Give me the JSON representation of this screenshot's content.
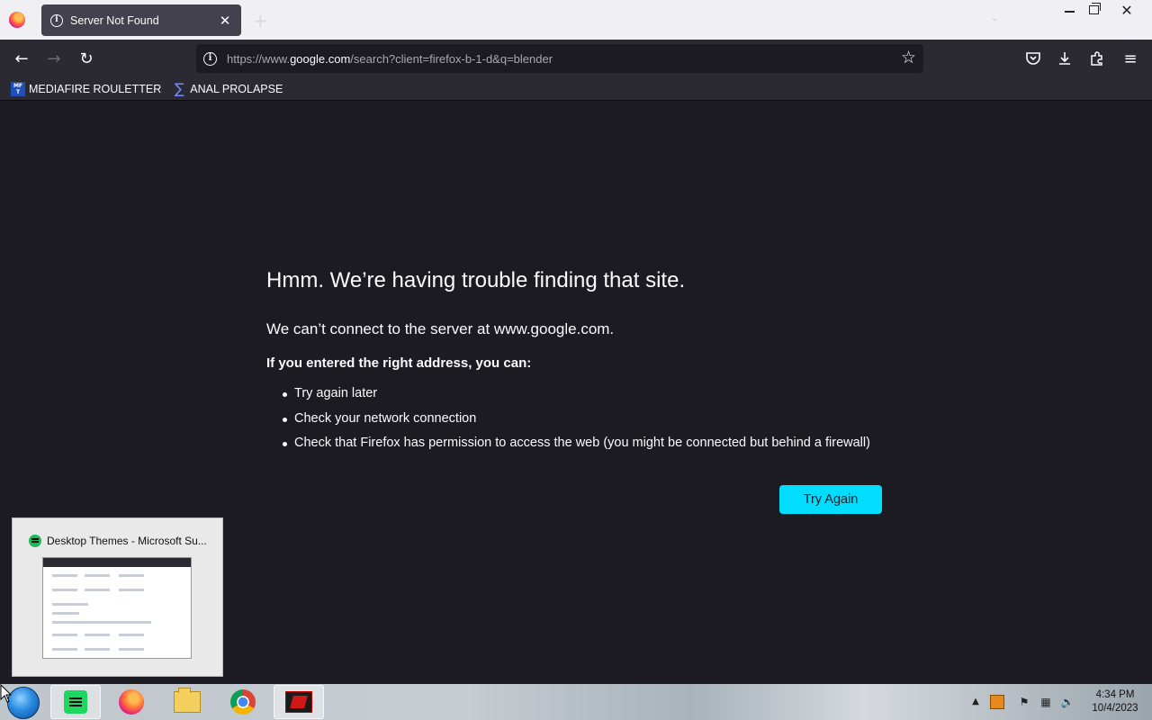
{
  "tab": {
    "title": "Server Not Found"
  },
  "urlbar": {
    "prefix": "https://www.",
    "host": "google.com",
    "path": "/search?client=firefox-b-1-d&q=blender"
  },
  "bookmarks": [
    {
      "label": "MEDIAFIRE ROULETTER",
      "icon_text": "MF T"
    },
    {
      "label": "ANAL PROLAPSE"
    }
  ],
  "error": {
    "title": "Hmm. We’re having trouble finding that site.",
    "short": "We can’t connect to the server at www.google.com.",
    "hint": "If you entered the right address, you can:",
    "items": [
      "Try again later",
      "Check your network connection",
      "Check that Firefox has permission to access the web (you might be connected but behind a firewall)"
    ],
    "button": "Try Again",
    "button_color": "#00ddff"
  },
  "thumbnail": {
    "title": "Desktop Themes - Microsoft Su..."
  },
  "clock": {
    "time": "4:34 PM",
    "date": "10/4/2023"
  },
  "colors": {
    "page_bg": "#1c1b22",
    "toolbar_bg": "#2b2a33",
    "tab_bg": "#42414d"
  }
}
